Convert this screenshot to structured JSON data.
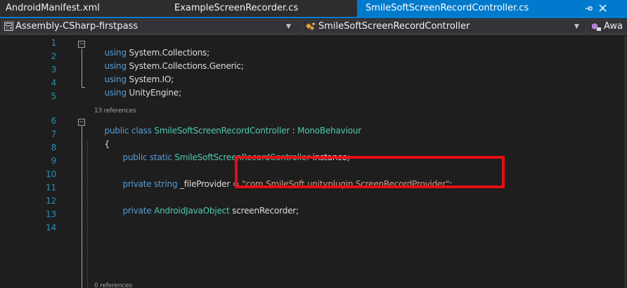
{
  "tabs": [
    {
      "label": "AndroidManifest.xml",
      "active": false
    },
    {
      "label": "ExampleScreenRecorder.cs",
      "active": false
    },
    {
      "label": "SmileSoftScreenRecordController.cs",
      "active": true
    }
  ],
  "tab_icons": {
    "pin": "pin-icon",
    "close": "close-icon"
  },
  "navbar": {
    "project": "Assembly-CSharp-firstpass",
    "type": "SmileSoftScreenRecordController",
    "member": "Awa"
  },
  "line_numbers": [
    "1",
    "2",
    "3",
    "4",
    "5",
    "6",
    "7",
    "8",
    "9",
    "10",
    "11",
    "12",
    "13",
    "14"
  ],
  "codelens": {
    "class_refs": "13 references",
    "next_refs": "0 references"
  },
  "code": {
    "l1": {
      "kw": "using",
      "ns": " System.Collections;"
    },
    "l2": {
      "kw": "using",
      "ns": " System.Collections.Generic;"
    },
    "l3": {
      "kw": "using",
      "ns": " System.IO;"
    },
    "l4": {
      "kw": "using",
      "ns": " UnityEngine;"
    },
    "l6": {
      "kw": "public class",
      "name": " SmileSoftScreenRecordController",
      "sep": " : ",
      "base": "MonoBehaviour"
    },
    "l7": {
      "brace": "{"
    },
    "l8": {
      "kw": "public static",
      "type": " SmileSoftScreenRecordController",
      "rest": " instance;"
    },
    "l10": {
      "kw": "private string",
      "field": " _fileProvider",
      "eq": " = ",
      "str": "\"com.SmileSoft.unityplugin.ScreenRecordProvider\"",
      "end": ";"
    },
    "l12": {
      "kw": "private",
      "type": " AndroidJavaObject",
      "rest": " screenRecorder;"
    }
  },
  "colors": {
    "accent": "#007acc",
    "highlight_box": "#e50f14",
    "keyword": "#569cd6",
    "type": "#4ec9b0",
    "string": "#d69d85",
    "line_number": "#2b91af"
  }
}
